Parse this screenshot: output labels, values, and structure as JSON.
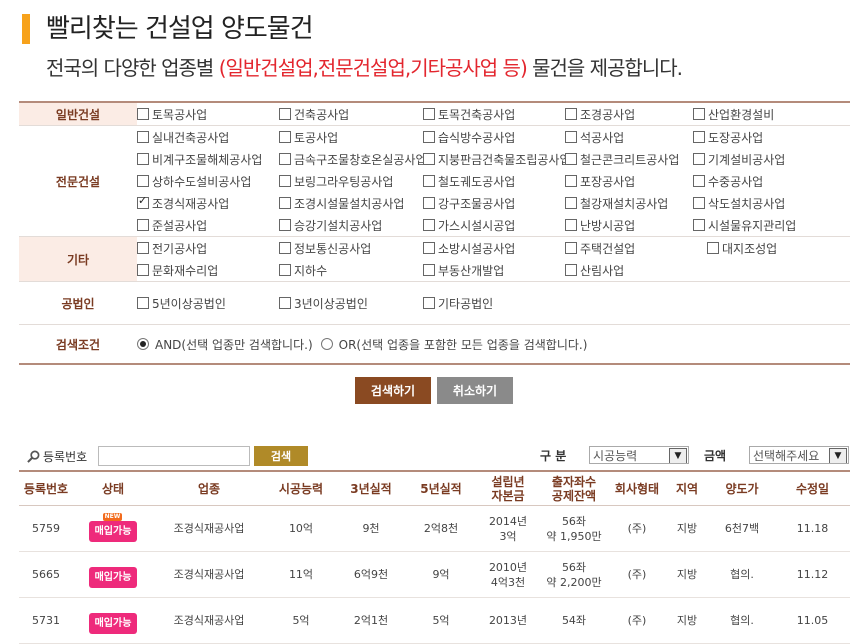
{
  "header": {
    "title": "빨리찾는 건설업 양도물건",
    "subtitle_pre": "전국의 다양한 업종별 ",
    "subtitle_highlight": "(일반건설업,전문건설업,기타공사업 등)",
    "subtitle_post": " 물건을 제공합니다."
  },
  "filters": {
    "general": {
      "label": "일반건설",
      "options": [
        {
          "label": "토목공사업",
          "checked": false
        },
        {
          "label": "건축공사업",
          "checked": false
        },
        {
          "label": "토목건축공사업",
          "checked": false
        },
        {
          "label": "조경공사업",
          "checked": false
        },
        {
          "label": "산업환경설비",
          "checked": false
        }
      ]
    },
    "special": {
      "label": "전문건설",
      "options": [
        {
          "label": "실내건축공사업",
          "checked": false
        },
        {
          "label": "토공사업",
          "checked": false
        },
        {
          "label": "습식방수공사업",
          "checked": false
        },
        {
          "label": "석공사업",
          "checked": false
        },
        {
          "label": "도장공사업",
          "checked": false
        },
        {
          "label": "비계구조물해체공사업",
          "checked": false
        },
        {
          "label": "금속구조물창호온실공사업",
          "checked": false
        },
        {
          "label": "지붕판금건축물조립공사업",
          "checked": false
        },
        {
          "label": "철근콘크리트공사업",
          "checked": false
        },
        {
          "label": "기계설비공사업",
          "checked": false
        },
        {
          "label": "상하수도설비공사업",
          "checked": false
        },
        {
          "label": "보링그라우팅공사업",
          "checked": false
        },
        {
          "label": "철도궤도공사업",
          "checked": false
        },
        {
          "label": "포장공사업",
          "checked": false
        },
        {
          "label": "수중공사업",
          "checked": false
        },
        {
          "label": "조경식재공사업",
          "checked": true
        },
        {
          "label": "조경시설물설치공사업",
          "checked": false
        },
        {
          "label": "강구조물공사업",
          "checked": false
        },
        {
          "label": "철강재설치공사업",
          "checked": false
        },
        {
          "label": "삭도설치공사업",
          "checked": false
        },
        {
          "label": "준설공사업",
          "checked": false
        },
        {
          "label": "승강기설치공사업",
          "checked": false
        },
        {
          "label": "가스시설시공업",
          "checked": false
        },
        {
          "label": "난방시공업",
          "checked": false
        },
        {
          "label": "시설물유지관리업",
          "checked": false
        }
      ]
    },
    "other": {
      "label": "기타",
      "options": [
        {
          "label": "전기공사업",
          "checked": false
        },
        {
          "label": "정보통신공사업",
          "checked": false
        },
        {
          "label": "소방시설공사업",
          "checked": false
        },
        {
          "label": "주택건설업",
          "checked": false
        },
        {
          "label": "대지조성업",
          "checked": false
        },
        {
          "label": "문화재수리업",
          "checked": false
        },
        {
          "label": "지하수",
          "checked": false
        },
        {
          "label": "부동산개발업",
          "checked": false
        },
        {
          "label": "산림사업",
          "checked": false
        }
      ]
    },
    "corp": {
      "label": "공법인",
      "options": [
        {
          "label": "5년이상공법인",
          "checked": false
        },
        {
          "label": "3년이상공법인",
          "checked": false
        },
        {
          "label": "기타공법인",
          "checked": false
        }
      ]
    },
    "condition": {
      "label": "검색조건",
      "and_label": "AND(선택 업종만 검색합니다.)",
      "or_label": "OR(선택 업종을 포함한 모든 업종을 검색합니다.)",
      "selected": "AND"
    }
  },
  "buttons": {
    "search": "검색하기",
    "cancel": "취소하기"
  },
  "search_bar": {
    "reg_label": "등록번호",
    "reg_value": "",
    "go": "검색",
    "category_label": "구 분",
    "category_value": "시공능력",
    "amount_label": "금액",
    "amount_value": "선택해주세요"
  },
  "table": {
    "headers": [
      {
        "l1": "등록번호",
        "l2": ""
      },
      {
        "l1": "상태",
        "l2": ""
      },
      {
        "l1": "업종",
        "l2": ""
      },
      {
        "l1": "시공능력",
        "l2": ""
      },
      {
        "l1": "3년실적",
        "l2": ""
      },
      {
        "l1": "5년실적",
        "l2": ""
      },
      {
        "l1": "설립년",
        "l2": "자본금"
      },
      {
        "l1": "출자좌수",
        "l2": "공제잔액"
      },
      {
        "l1": "회사형태",
        "l2": ""
      },
      {
        "l1": "지역",
        "l2": ""
      },
      {
        "l1": "양도가",
        "l2": ""
      },
      {
        "l1": "수정일",
        "l2": ""
      }
    ],
    "rows": [
      {
        "id": "5759",
        "status": "매입가능",
        "is_new": true,
        "new_label": "NEW",
        "industry": "조경식재공사업",
        "capacity": "10억",
        "y3": "9천",
        "y5": "2억8천",
        "est1": "2014년",
        "est2": "3억",
        "seats1": "56좌",
        "seats2": "약 1,950만",
        "corp": "(주)",
        "region": "지방",
        "price": "6천7백",
        "updated": "11.18"
      },
      {
        "id": "5665",
        "status": "매입가능",
        "is_new": false,
        "new_label": "",
        "industry": "조경식재공사업",
        "capacity": "11억",
        "y3": "6억9천",
        "y5": "9억",
        "est1": "2010년",
        "est2": "4억3천",
        "seats1": "56좌",
        "seats2": "약 2,200만",
        "corp": "(주)",
        "region": "지방",
        "price": "협의.",
        "updated": "11.12"
      },
      {
        "id": "5731",
        "status": "매입가능",
        "is_new": false,
        "new_label": "",
        "industry": "조경식재공사업",
        "capacity": "5억",
        "y3": "2억1천",
        "y5": "5억",
        "est1": "2013년",
        "est2": "",
        "seats1": "54좌",
        "seats2": "",
        "corp": "(주)",
        "region": "지방",
        "price": "협의.",
        "updated": "11.05"
      }
    ]
  }
}
